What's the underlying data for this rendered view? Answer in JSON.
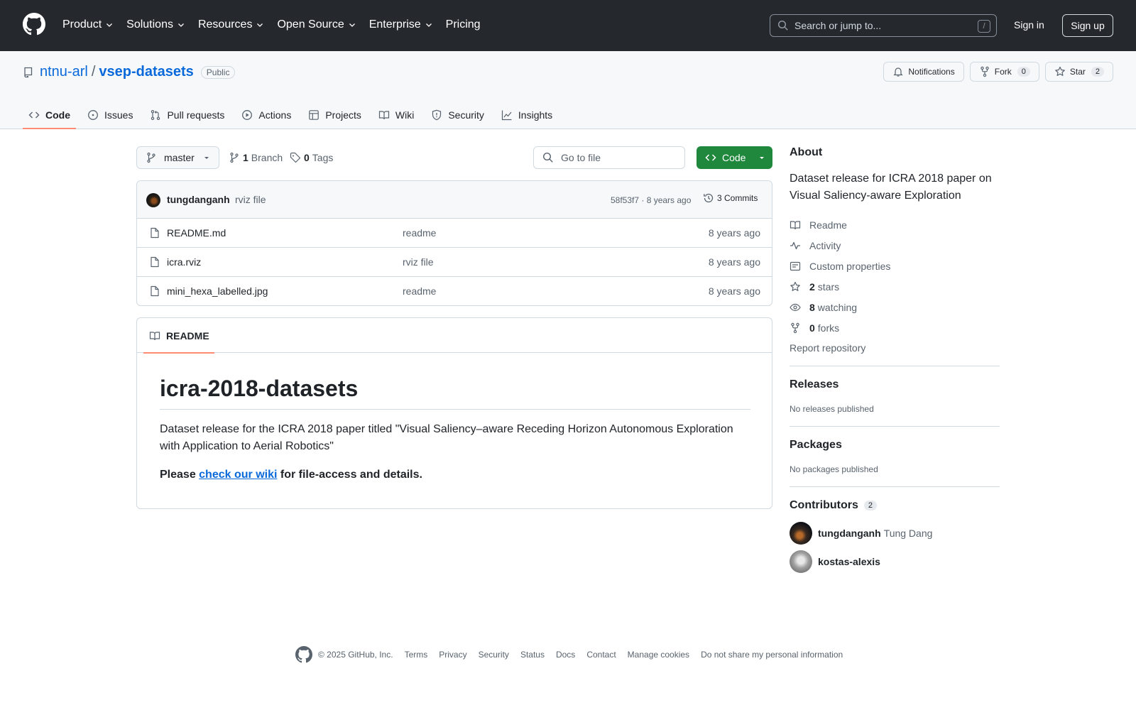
{
  "header": {
    "nav": [
      "Product",
      "Solutions",
      "Resources",
      "Open Source",
      "Enterprise",
      "Pricing"
    ],
    "search_placeholder": "Search or jump to...",
    "search_shortcut": "/",
    "sign_in": "Sign in",
    "sign_up": "Sign up"
  },
  "repo": {
    "owner": "ntnu-arl",
    "separator": "/",
    "name": "vsep-datasets",
    "visibility": "Public",
    "notifications_label": "Notifications",
    "fork_label": "Fork",
    "fork_count": "0",
    "star_label": "Star",
    "star_count": "2"
  },
  "tabs": [
    "Code",
    "Issues",
    "Pull requests",
    "Actions",
    "Projects",
    "Wiki",
    "Security",
    "Insights"
  ],
  "file_nav": {
    "branch": "master",
    "branch_count": "1",
    "branch_label": "Branch",
    "tag_count": "0",
    "tag_label": "Tags",
    "goto_placeholder": "Go to file",
    "code_button": "Code"
  },
  "commit": {
    "author": "tungdanganh",
    "message": "rviz file",
    "sha_age": "58f53f7 · 8 years ago",
    "commits_label": "3 Commits"
  },
  "files": [
    {
      "name": "README.md",
      "message": "readme",
      "age": "8 years ago"
    },
    {
      "name": "icra.rviz",
      "message": "rviz file",
      "age": "8 years ago"
    },
    {
      "name": "mini_hexa_labelled.jpg",
      "message": "readme",
      "age": "8 years ago"
    }
  ],
  "readme": {
    "tab_label": "README",
    "title": "icra-2018-datasets",
    "paragraph": "Dataset release for the ICRA 2018 paper titled \"Visual Saliency–aware Receding Horizon Autonomous Exploration with Application to Aerial Robotics\"",
    "cta_prefix": "Please ",
    "cta_link": "check our wiki",
    "cta_suffix": " for file-access and details."
  },
  "about": {
    "heading": "About",
    "description": "Dataset release for ICRA 2018 paper on Visual Saliency-aware Exploration",
    "readme": "Readme",
    "activity": "Activity",
    "custom_properties": "Custom properties",
    "stars_count": "2",
    "stars_label": "stars",
    "watching_count": "8",
    "watching_label": "watching",
    "forks_count": "0",
    "forks_label": "forks",
    "report": "Report repository"
  },
  "releases": {
    "heading": "Releases",
    "text": "No releases published"
  },
  "packages": {
    "heading": "Packages",
    "text": "No packages published"
  },
  "contributors": {
    "heading": "Contributors",
    "count": "2",
    "list": [
      {
        "login": "tungdanganh",
        "name": "Tung Dang"
      },
      {
        "login": "kostas-alexis",
        "name": ""
      }
    ]
  },
  "footer": {
    "copyright": "© 2025 GitHub, Inc.",
    "links": [
      "Terms",
      "Privacy",
      "Security",
      "Status",
      "Docs",
      "Contact",
      "Manage cookies",
      "Do not share my personal information"
    ]
  },
  "colors": {
    "header_bg": "#25292e",
    "link_blue": "#0969da",
    "code_green": "#1f883d",
    "tab_underline": "#fd8c73"
  }
}
